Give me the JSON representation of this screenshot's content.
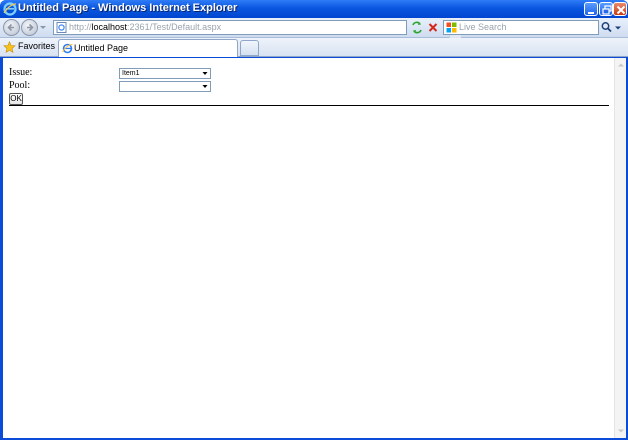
{
  "window": {
    "title": "Untitled Page - Windows Internet Explorer"
  },
  "address_bar": {
    "url_prefix": "http://",
    "url_host": "localhost",
    "url_rest": ":2361/Test/Default.aspx"
  },
  "search": {
    "placeholder": "Live Search"
  },
  "tabs": {
    "favorites_label": "Favorites",
    "active_tab_label": "Untitled Page"
  },
  "form": {
    "issue_label": "Issue:",
    "issue_value": "Item1",
    "pool_label": "Pool:",
    "pool_value": "",
    "ok_label": "OK"
  },
  "icons": {
    "ie": "ie-logo-icon",
    "minimize": "minimize-icon",
    "maximize": "maximize-icon",
    "close": "close-icon",
    "back": "back-arrow-icon",
    "forward": "forward-arrow-icon",
    "refresh": "refresh-icon",
    "stop": "stop-icon",
    "search": "magnifier-icon",
    "favorites": "star-icon"
  },
  "colors": {
    "titlebar": "#0a57e0",
    "close_button": "#cb3a12",
    "content_bg": "#ffffff"
  }
}
